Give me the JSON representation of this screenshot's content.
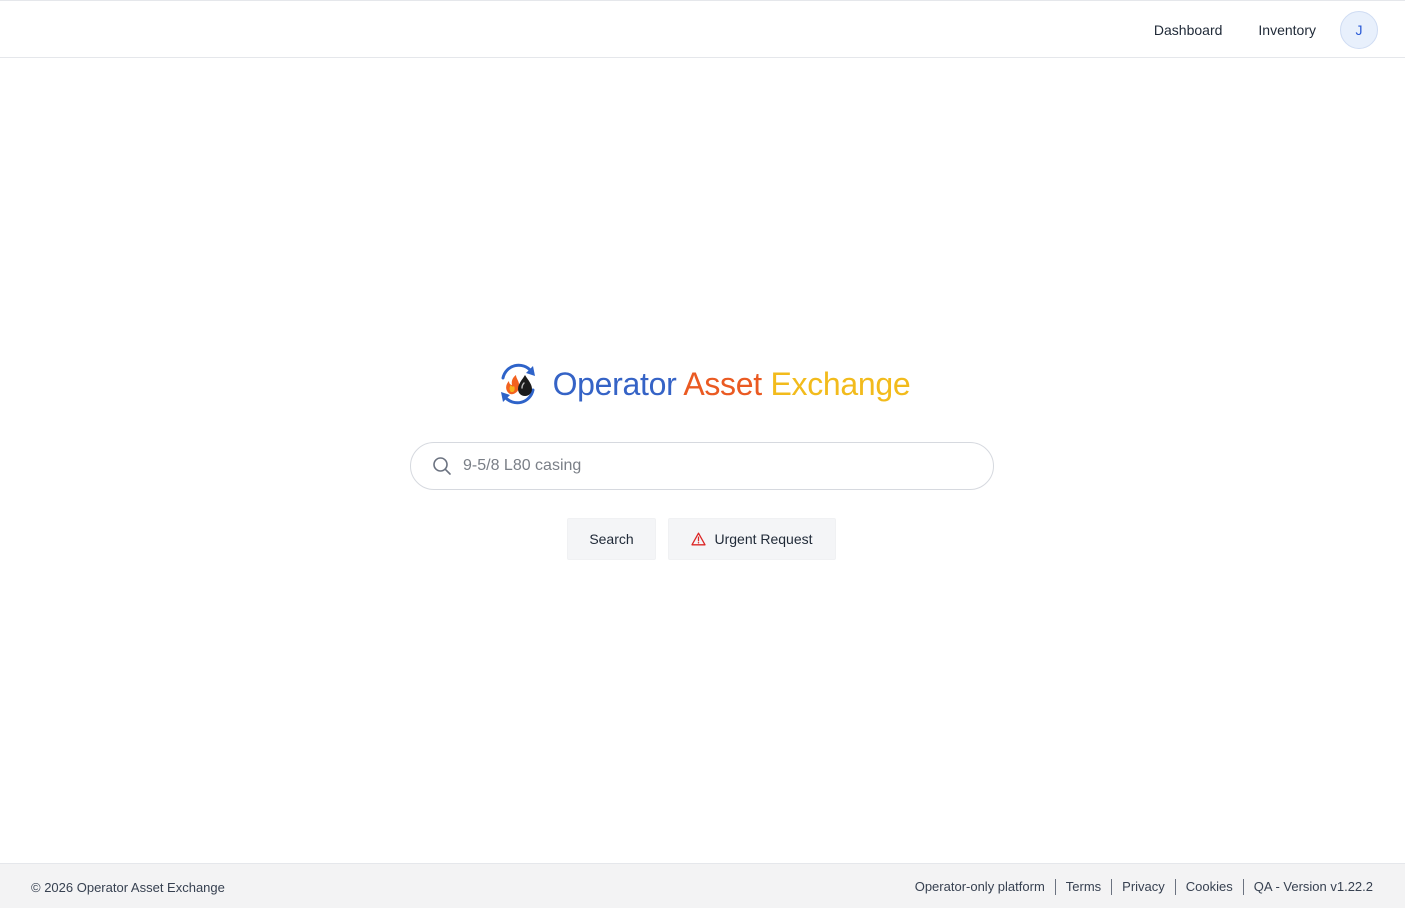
{
  "header": {
    "nav": {
      "dashboard": "Dashboard",
      "inventory": "Inventory"
    },
    "avatar_initial": "J"
  },
  "brand": {
    "word1": "Operator",
    "word2": "Asset",
    "word3": "Exchange",
    "colors": {
      "word1": "#3563c6",
      "word2": "#ea5a22",
      "word3": "#f2bb1c"
    },
    "logo_icon": "flame-and-oil-drop-cycle-icon"
  },
  "search": {
    "placeholder": "9-5/8 L80 casing",
    "value": ""
  },
  "actions": {
    "search_label": "Search",
    "urgent_label": "Urgent Request",
    "urgent_icon": "warning-triangle-icon",
    "urgent_icon_color": "#dc2626"
  },
  "footer": {
    "copyright": "© 2026 Operator Asset Exchange",
    "links": {
      "operator_only": "Operator-only platform",
      "terms": "Terms",
      "privacy": "Privacy",
      "cookies": "Cookies",
      "version": "QA - Version v1.22.2"
    }
  }
}
